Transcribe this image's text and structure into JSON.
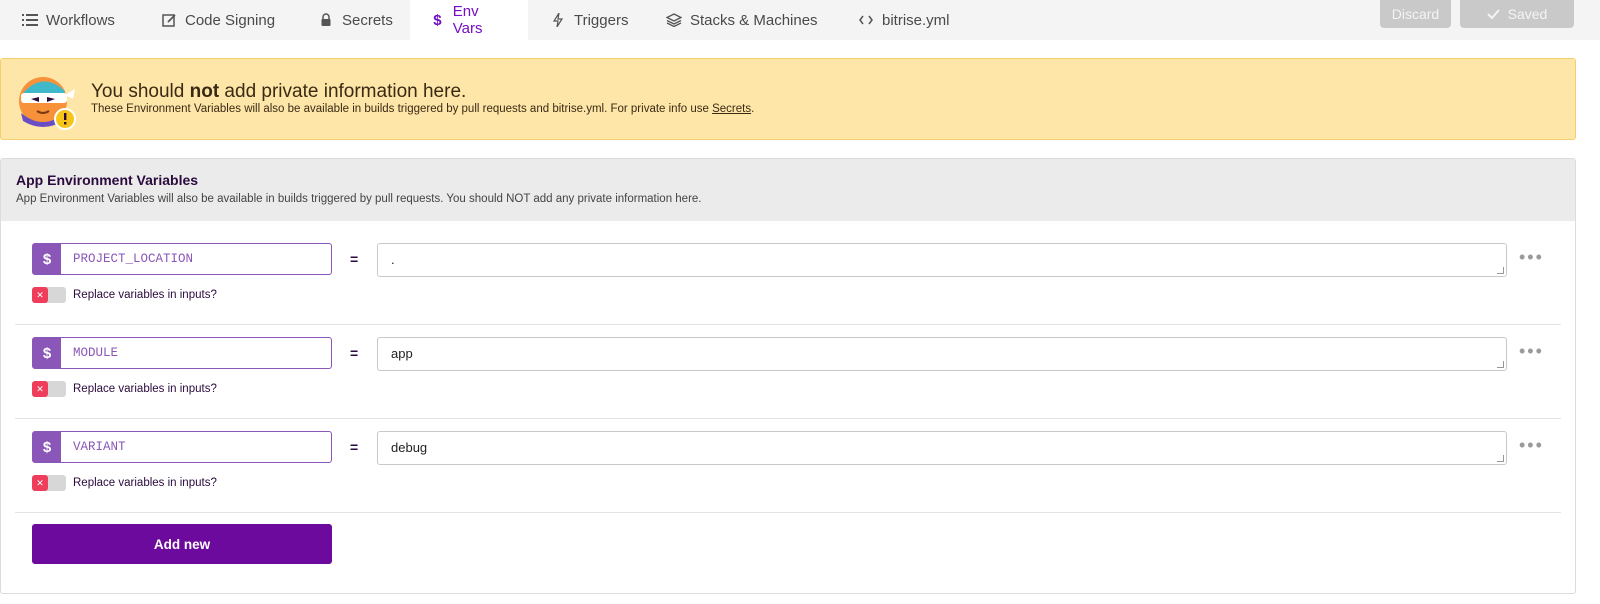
{
  "tabs": [
    {
      "label": "Workflows",
      "icon": "list-icon"
    },
    {
      "label": "Code Signing",
      "icon": "edit-icon"
    },
    {
      "label": "Secrets",
      "icon": "lock-icon"
    },
    {
      "label": "Env Vars",
      "icon": "dollar-icon",
      "active": true
    },
    {
      "label": "Triggers",
      "icon": "bolt-icon"
    },
    {
      "label": "Stacks & Machines",
      "icon": "layers-icon"
    },
    {
      "label": "bitrise.yml",
      "icon": "code-icon"
    }
  ],
  "actions": {
    "discard_label": "Discard",
    "saved_label": "Saved"
  },
  "banner": {
    "title_pre": "You should ",
    "title_bold": "not",
    "title_post": " add private information here.",
    "sub_text": "These Environment Variables will also be available in builds triggered by pull requests and bitrise.yml. For private info use ",
    "sub_link": "Secrets",
    "sub_end": "."
  },
  "section": {
    "title": "App Environment Variables",
    "subtitle": "App Environment Variables will also be available in builds triggered by pull requests. You should NOT add any private information here."
  },
  "env_vars": [
    {
      "key": "PROJECT_LOCATION",
      "value": ".",
      "replace_label": "Replace variables in inputs?",
      "replace_enabled": false
    },
    {
      "key": "MODULE",
      "value": "app",
      "replace_label": "Replace variables in inputs?",
      "replace_enabled": false
    },
    {
      "key": "VARIANT",
      "value": "debug",
      "replace_label": "Replace variables in inputs?",
      "replace_enabled": false
    }
  ],
  "add_new_label": "Add new",
  "colors": {
    "accent": "#760fc3",
    "button": "#6c0a9e",
    "key_purple": "#8a56b8",
    "toggle_off": "#ef3e5c",
    "banner_bg": "#fde6a8"
  }
}
